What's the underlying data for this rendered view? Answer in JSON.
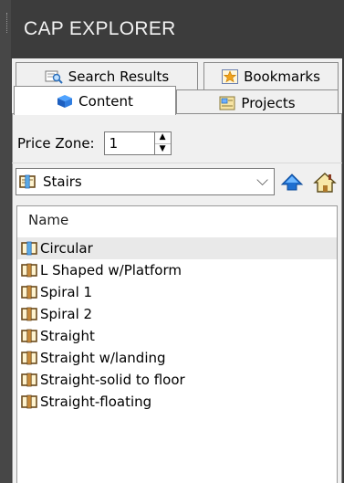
{
  "window": {
    "title": "CAP EXPLORER"
  },
  "tabs": {
    "search_results": "Search Results",
    "bookmarks": "Bookmarks",
    "content": "Content",
    "projects": "Projects"
  },
  "price_zone": {
    "label": "Price Zone:",
    "value": "1"
  },
  "category": {
    "selected": "Stairs"
  },
  "list": {
    "header": "Name",
    "items": [
      {
        "label": "Circular",
        "selected": true
      },
      {
        "label": "L Shaped w/Platform"
      },
      {
        "label": "Spiral 1"
      },
      {
        "label": "Spiral 2"
      },
      {
        "label": "Straight"
      },
      {
        "label": "Straight w/landing"
      },
      {
        "label": "Straight-solid to floor"
      },
      {
        "label": "Straight-floating"
      }
    ]
  },
  "colors": {
    "background": "#3c3c3c",
    "panel": "#f0f0f0",
    "accent_blue": "#1e6fd0",
    "book_icon": "#6b4a1c"
  }
}
